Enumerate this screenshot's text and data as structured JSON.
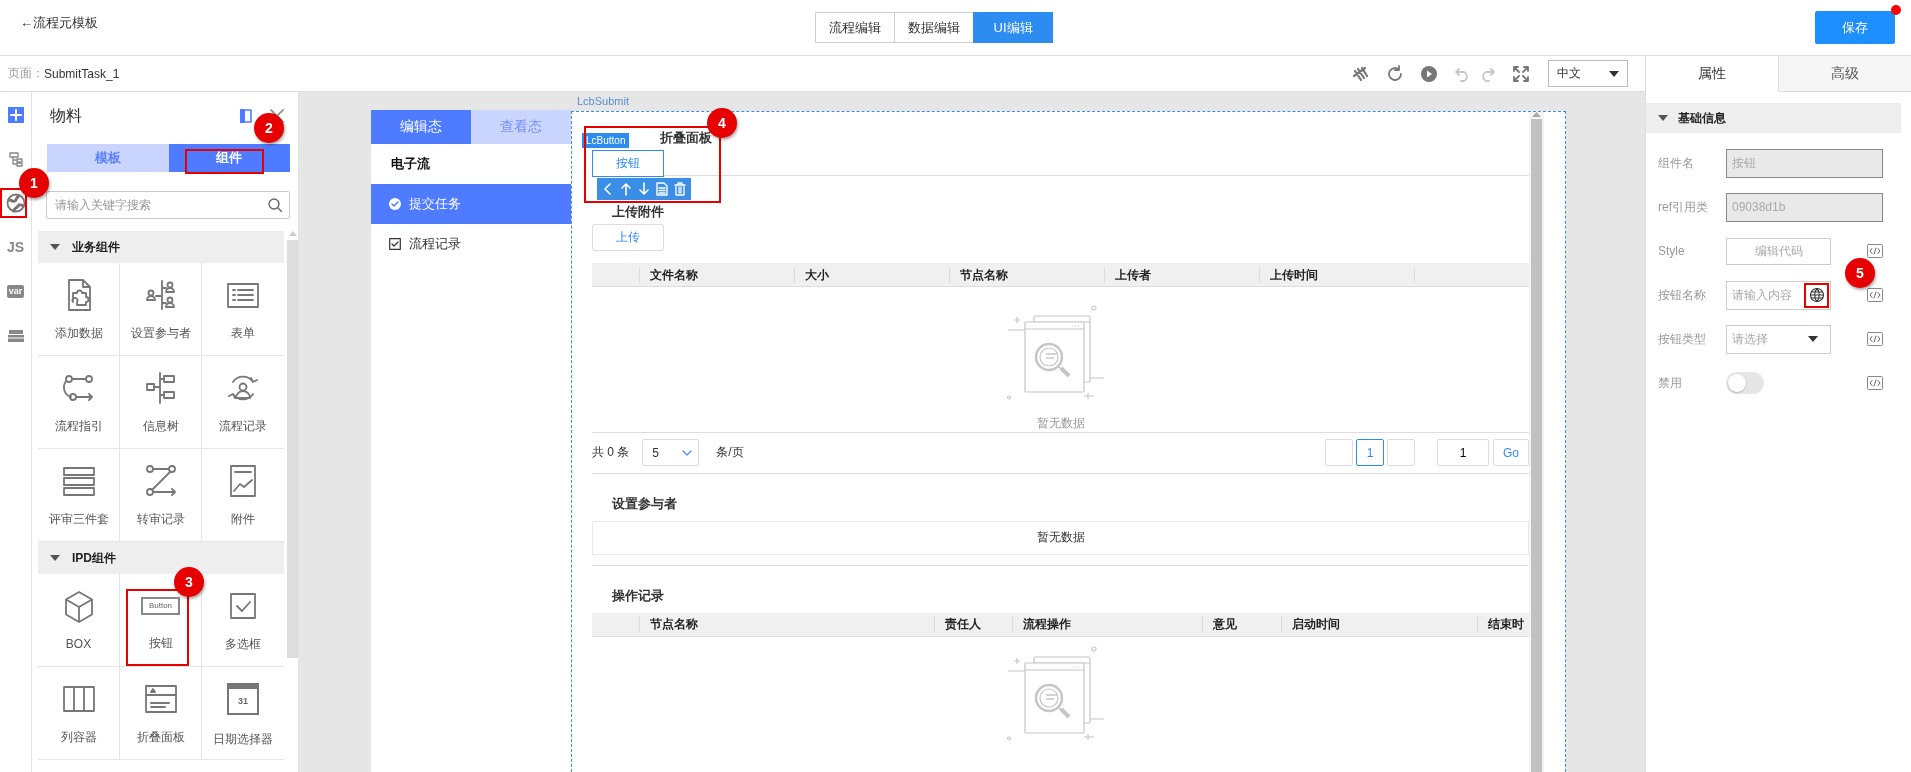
{
  "header": {
    "back_link": "←流程元模板",
    "mode_tabs": [
      {
        "label": "流程编辑",
        "selected": false
      },
      {
        "label": "数据编辑",
        "selected": false
      },
      {
        "label": "UI编辑",
        "selected": true
      }
    ],
    "save_button": {
      "label": "保存",
      "unsaved": true
    }
  },
  "toolbar": {
    "page_label": "页面：",
    "page_name": "SubmitTask_1",
    "undo_disabled": true,
    "redo_disabled": true,
    "language": "中文"
  },
  "rail": [
    {
      "kind": "plus"
    },
    {
      "kind": "tree"
    },
    {
      "kind": "globe"
    },
    {
      "kind": "text",
      "label": "JS"
    },
    {
      "kind": "tag",
      "label": "var"
    },
    {
      "kind": "storage"
    }
  ],
  "materials": {
    "title": "物料",
    "tabs": [
      {
        "label": "模板",
        "selected": false
      },
      {
        "label": "组件",
        "selected": true
      }
    ],
    "search_placeholder": "请输入关键字搜索",
    "groups": [
      {
        "title": "业务组件",
        "expanded": true,
        "items": [
          {
            "label": "添加数据",
            "kind": "puzzle"
          },
          {
            "label": "设置参与者",
            "kind": "people"
          },
          {
            "label": "表单",
            "kind": "list"
          },
          {
            "label": "流程指引",
            "kind": "flow"
          },
          {
            "label": "信息树",
            "kind": "tree"
          },
          {
            "label": "流程记录",
            "kind": "cycle"
          },
          {
            "label": "评审三件套",
            "kind": "stack"
          },
          {
            "label": "转审记录",
            "kind": "transfer"
          },
          {
            "label": "附件",
            "kind": "chart"
          }
        ]
      },
      {
        "title": "IPD组件",
        "expanded": true,
        "items": [
          {
            "label": "BOX",
            "kind": "cube"
          },
          {
            "label": "按钮",
            "kind": "button",
            "icon_text": "Button"
          },
          {
            "label": "多选框",
            "kind": "checkbox"
          },
          {
            "label": "列容器",
            "kind": "columns"
          },
          {
            "label": "折叠面板",
            "kind": "panel"
          },
          {
            "label": "日期选择器",
            "kind": "calendar",
            "icon_text": "31"
          }
        ]
      }
    ]
  },
  "phone": {
    "tabs": [
      {
        "label": "编辑态",
        "selected": true
      },
      {
        "label": "查看态",
        "selected": false
      }
    ],
    "title": "电子流",
    "nav": [
      {
        "label": "提交任务",
        "kind": "check-circle",
        "selected": true
      },
      {
        "label": "流程记录",
        "kind": "checkbox",
        "selected": false
      }
    ]
  },
  "canvas": {
    "root_label": "LcbSubmit",
    "selected_label": "LcButton",
    "collapse_title": "折叠面板",
    "button_label": "按钮",
    "attach": {
      "title": "上传附件",
      "upload": "上传",
      "columns": [
        "文件名称",
        "大小",
        "节点名称",
        "上传者",
        "上传时间"
      ],
      "empty": "暂无数据"
    },
    "pagination": {
      "total": "共 0 条",
      "page_size": "5",
      "per_page": "条/页",
      "pages": [
        {
          "label": "1",
          "selected": true
        }
      ],
      "jump": "1",
      "go": "Go"
    },
    "participants": {
      "title": "设置参与者",
      "empty": "暂无数据"
    },
    "records": {
      "title": "操作记录",
      "columns": [
        "节点名称",
        "责任人",
        "流程操作",
        "意见",
        "启动时间",
        "结束时"
      ]
    }
  },
  "properties": {
    "tabs": [
      {
        "label": "属性",
        "selected": true
      },
      {
        "label": "高级",
        "selected": false
      }
    ],
    "section": {
      "title": "基础信息",
      "expanded": true
    },
    "fields": [
      {
        "label": "组件名",
        "kind": "readonly",
        "value": "按钮"
      },
      {
        "label": "ref引用类",
        "kind": "readonly",
        "value": "09038d1b"
      },
      {
        "label": "Style",
        "kind": "code_button",
        "value": "编辑代码"
      },
      {
        "label": "按钮名称",
        "kind": "i18n_input",
        "placeholder": "请输入内容"
      },
      {
        "label": "按钮类型",
        "kind": "select",
        "placeholder": "请选择"
      },
      {
        "label": "禁用",
        "kind": "switch",
        "on": false
      }
    ]
  },
  "callouts": [
    {
      "number": "1"
    },
    {
      "number": "2"
    },
    {
      "number": "3"
    },
    {
      "number": "4"
    },
    {
      "number": "5"
    }
  ]
}
